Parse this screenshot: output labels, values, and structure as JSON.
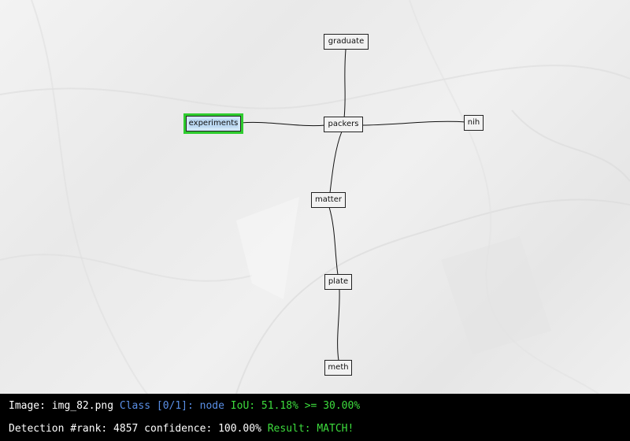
{
  "graph": {
    "nodes": [
      {
        "id": "graduate",
        "label": "graduate",
        "highlighted": false
      },
      {
        "id": "experiments",
        "label": "experiments",
        "highlighted": true
      },
      {
        "id": "packers",
        "label": "packers",
        "highlighted": false
      },
      {
        "id": "nih",
        "label": "nih",
        "highlighted": false
      },
      {
        "id": "matter",
        "label": "matter",
        "highlighted": false
      },
      {
        "id": "plate",
        "label": "plate",
        "highlighted": false
      },
      {
        "id": "meth",
        "label": "meth",
        "highlighted": false
      }
    ],
    "edges": [
      [
        "graduate",
        "packers"
      ],
      [
        "experiments",
        "packers"
      ],
      [
        "packers",
        "nih"
      ],
      [
        "packers",
        "matter"
      ],
      [
        "matter",
        "plate"
      ],
      [
        "plate",
        "meth"
      ]
    ],
    "colors": {
      "highlight_border": "#2ecc2e",
      "highlight_fill": "#cfe6f7",
      "node_border": "#222222",
      "edge": "#111111"
    }
  },
  "status": {
    "image_label": "Image:",
    "image_name": "img_82.png",
    "class_label": "Class [0/1]:",
    "class_name": "node",
    "iou_text": "IoU: 51.18% >= 30.00%",
    "detection_text": "Detection #rank: 4857 confidence: 100.00%",
    "result_text": "Result: MATCH!",
    "colors": {
      "white": "#ffffff",
      "blue": "#5a8fe6",
      "green": "#3ddc3d"
    }
  }
}
